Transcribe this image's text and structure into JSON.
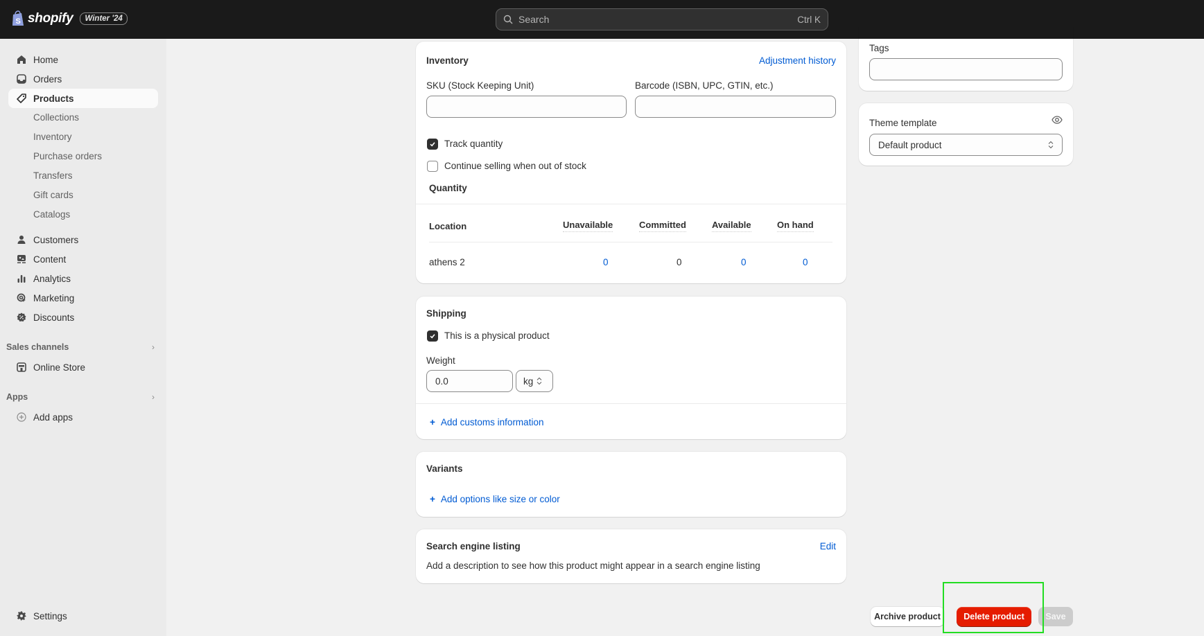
{
  "topbar": {
    "brand": "shopify",
    "version_badge": "Winter '24",
    "search_placeholder": "Search",
    "search_shortcut": "Ctrl K"
  },
  "sidebar": {
    "main_items": [
      {
        "label": "Home",
        "icon": "home-icon"
      },
      {
        "label": "Orders",
        "icon": "orders-icon"
      },
      {
        "label": "Products",
        "icon": "tag-icon",
        "active": true
      }
    ],
    "product_subitems": [
      "Collections",
      "Inventory",
      "Purchase orders",
      "Transfers",
      "Gift cards",
      "Catalogs"
    ],
    "more_items": [
      {
        "label": "Customers",
        "icon": "person-icon"
      },
      {
        "label": "Content",
        "icon": "content-icon"
      },
      {
        "label": "Analytics",
        "icon": "bar-chart-icon"
      },
      {
        "label": "Marketing",
        "icon": "target-icon"
      },
      {
        "label": "Discounts",
        "icon": "discount-icon"
      }
    ],
    "sales_channels": {
      "heading": "Sales channels",
      "items": [
        {
          "label": "Online Store",
          "icon": "store-icon"
        }
      ]
    },
    "apps": {
      "heading": "Apps",
      "items": [
        {
          "label": "Add apps",
          "icon": "plus-circle-icon"
        }
      ]
    },
    "settings": {
      "label": "Settings",
      "icon": "gear-icon"
    }
  },
  "inventory": {
    "title": "Inventory",
    "adjustment_link": "Adjustment history",
    "sku_label": "SKU (Stock Keeping Unit)",
    "sku_value": "",
    "barcode_label": "Barcode (ISBN, UPC, GTIN, etc.)",
    "barcode_value": "",
    "track_quantity": {
      "label": "Track quantity",
      "checked": true
    },
    "continue_selling": {
      "label": "Continue selling when out of stock",
      "checked": false
    },
    "quantity_heading": "Quantity",
    "table": {
      "headers": [
        "Location",
        "Unavailable",
        "Committed",
        "Available",
        "On hand"
      ],
      "rows": [
        {
          "location": "athens 2",
          "unavailable": "0",
          "committed": "0",
          "available": "0",
          "on_hand": "0"
        }
      ]
    }
  },
  "shipping": {
    "title": "Shipping",
    "physical_product": {
      "label": "This is a physical product",
      "checked": true
    },
    "weight_label": "Weight",
    "weight_value": "0.0",
    "weight_unit": "kg",
    "customs_link": "Add customs information"
  },
  "variants": {
    "title": "Variants",
    "add_options_link": "Add options like size or color"
  },
  "seo": {
    "title": "Search engine listing",
    "edit_link": "Edit",
    "description": "Add a description to see how this product might appear in a search engine listing"
  },
  "right": {
    "tags_label": "Tags",
    "tags_value": "",
    "theme_template_label": "Theme template",
    "theme_template_value": "Default product"
  },
  "actions": {
    "archive": "Archive product",
    "delete": "Delete product",
    "save": "Save"
  },
  "colors": {
    "topbar": "#1a1a1a",
    "link": "#005bd3",
    "danger": "#e51c00",
    "highlight": "#22dd22"
  }
}
